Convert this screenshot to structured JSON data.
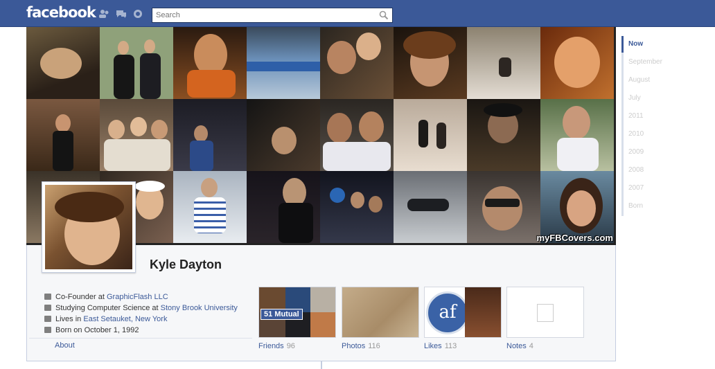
{
  "header": {
    "logo": "facebook",
    "search_placeholder": "Search"
  },
  "profile": {
    "name": "Kyle Dayton",
    "watermark": "myFBCovers.com",
    "info": [
      {
        "icon": "briefcase-icon",
        "prefix": "Co-Founder at ",
        "link": "GraphicFlash LLC",
        "suffix": ""
      },
      {
        "icon": "graduation-cap-icon",
        "prefix": "Studying Computer Science at ",
        "link": "Stony Brook University",
        "suffix": ""
      },
      {
        "icon": "home-icon",
        "prefix": "Lives in ",
        "link": "East Setauket",
        "suffix": ", New York"
      },
      {
        "icon": "calendar-icon",
        "prefix": "Born on October 1, 1992",
        "link": "",
        "suffix": ""
      }
    ],
    "about_label": "About"
  },
  "boxes": {
    "friends": {
      "label": "Friends",
      "count": "96",
      "mutual": "51 Mutual"
    },
    "photos": {
      "label": "Photos",
      "count": "116"
    },
    "likes": {
      "label": "Likes",
      "count": "113",
      "logo_text": "af"
    },
    "notes": {
      "label": "Notes",
      "count": "4"
    }
  },
  "timeline": [
    "Now",
    "September",
    "August",
    "July",
    "2011",
    "2010",
    "2009",
    "2008",
    "2007",
    "Born"
  ],
  "colors": {
    "brand": "#3b5998",
    "panel": "#f6f7f9"
  }
}
